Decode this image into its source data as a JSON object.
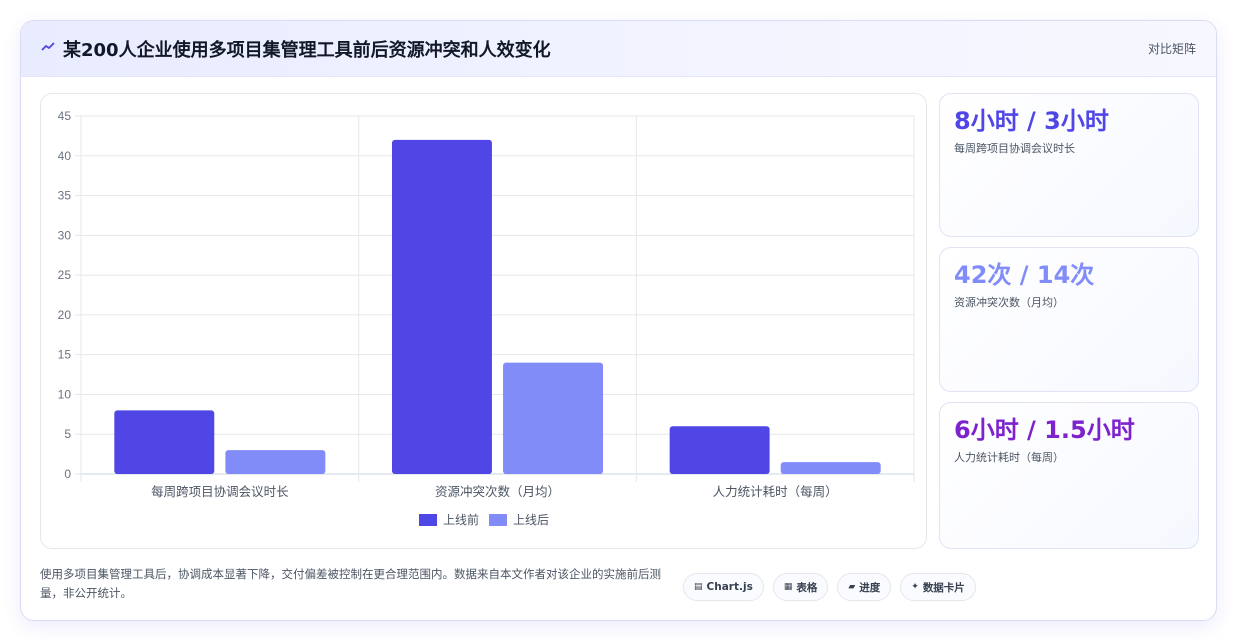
{
  "header": {
    "title": "某200人企业使用多项目集管理工具前后资源冲突和人效变化",
    "icon": "chart-line-icon",
    "tag": "对比矩阵"
  },
  "colors": {
    "before": "#4f46e5",
    "after": "#818cf8",
    "stat1": "#4f46e5",
    "stat2": "#818cf8",
    "stat3": "#7e22ce"
  },
  "chart_data": {
    "type": "bar",
    "categories": [
      "每周跨项目协调会议时长",
      "资源冲突次数（月均）",
      "人力统计耗时（每周）"
    ],
    "series": [
      {
        "name": "上线前",
        "values": [
          8,
          42,
          6
        ]
      },
      {
        "name": "上线后",
        "values": [
          3,
          14,
          1.5
        ]
      }
    ],
    "ylim": [
      0,
      45
    ],
    "yticks": [
      0,
      5,
      10,
      15,
      20,
      25,
      30,
      35,
      40,
      45
    ],
    "grid": true,
    "legend": "bottom"
  },
  "stats": [
    {
      "value": "8小时 / 3小时",
      "label": "每周跨项目协调会议时长"
    },
    {
      "value": "42次 / 14次",
      "label": "资源冲突次数（月均）"
    },
    {
      "value": "6小时 / 1.5小时",
      "label": "人力统计耗时（每周）"
    }
  ],
  "footnote": "使用多项目集管理工具后，协调成本显著下降，交付偏差被控制在更合理范围内。数据来自本文作者对该企业的实施前后测量，非公开统计。",
  "chips": [
    {
      "icon": "chart-icon",
      "label": "Chart.js"
    },
    {
      "icon": "table-icon",
      "label": "表格"
    },
    {
      "icon": "progress-icon",
      "label": "进度"
    },
    {
      "icon": "sparkle-icon",
      "label": "数据卡片"
    }
  ]
}
